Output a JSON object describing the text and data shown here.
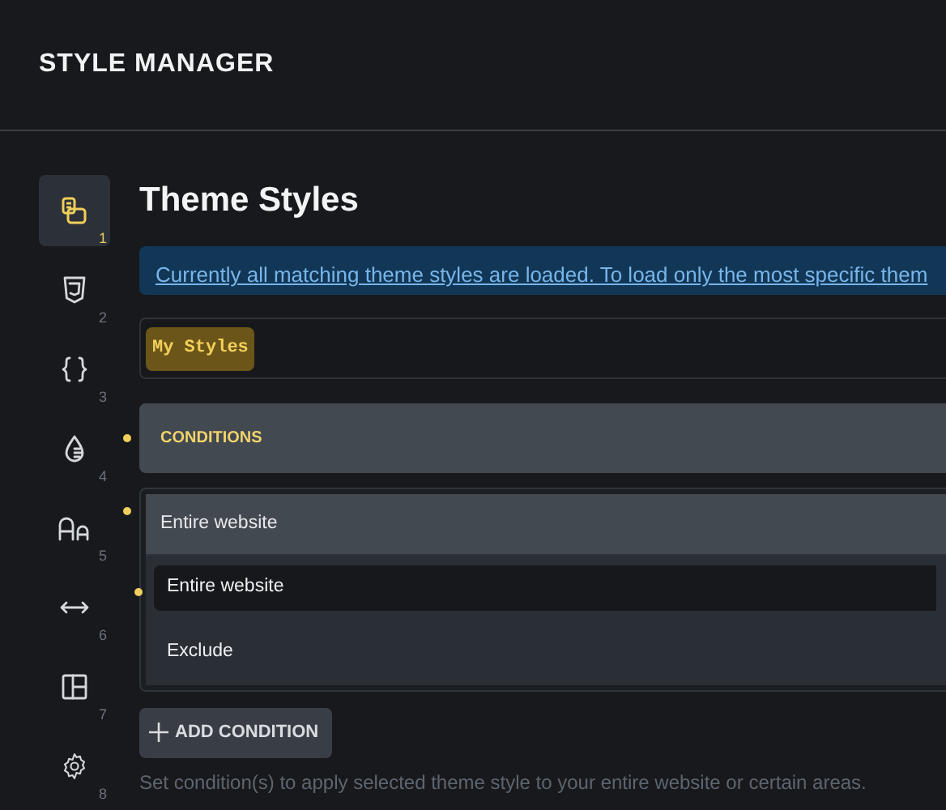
{
  "header": {
    "title": "STYLE MANAGER"
  },
  "sidebar": {
    "items": [
      {
        "number": "1",
        "selected": true
      },
      {
        "number": "2",
        "selected": false
      },
      {
        "number": "3",
        "selected": false
      },
      {
        "number": "4",
        "selected": false
      },
      {
        "number": "5",
        "selected": false
      },
      {
        "number": "6",
        "selected": false
      },
      {
        "number": "7",
        "selected": false
      },
      {
        "number": "8",
        "selected": false
      }
    ]
  },
  "main": {
    "title": "Theme Styles",
    "notice": "Currently all matching theme styles are loaded. To load only the most specific them",
    "style_tag": "My Styles",
    "conditions": {
      "label": "CONDITIONS",
      "modified": true,
      "group": {
        "title": "Entire website",
        "modified": true,
        "items": [
          {
            "label": "Entire website",
            "modified": true,
            "selected": true
          },
          {
            "label": "Exclude",
            "modified": false,
            "selected": false
          }
        ]
      }
    },
    "add_button": "ADD CONDITION",
    "help": "Set condition(s) to apply selected theme style to your entire website or certain areas."
  }
}
